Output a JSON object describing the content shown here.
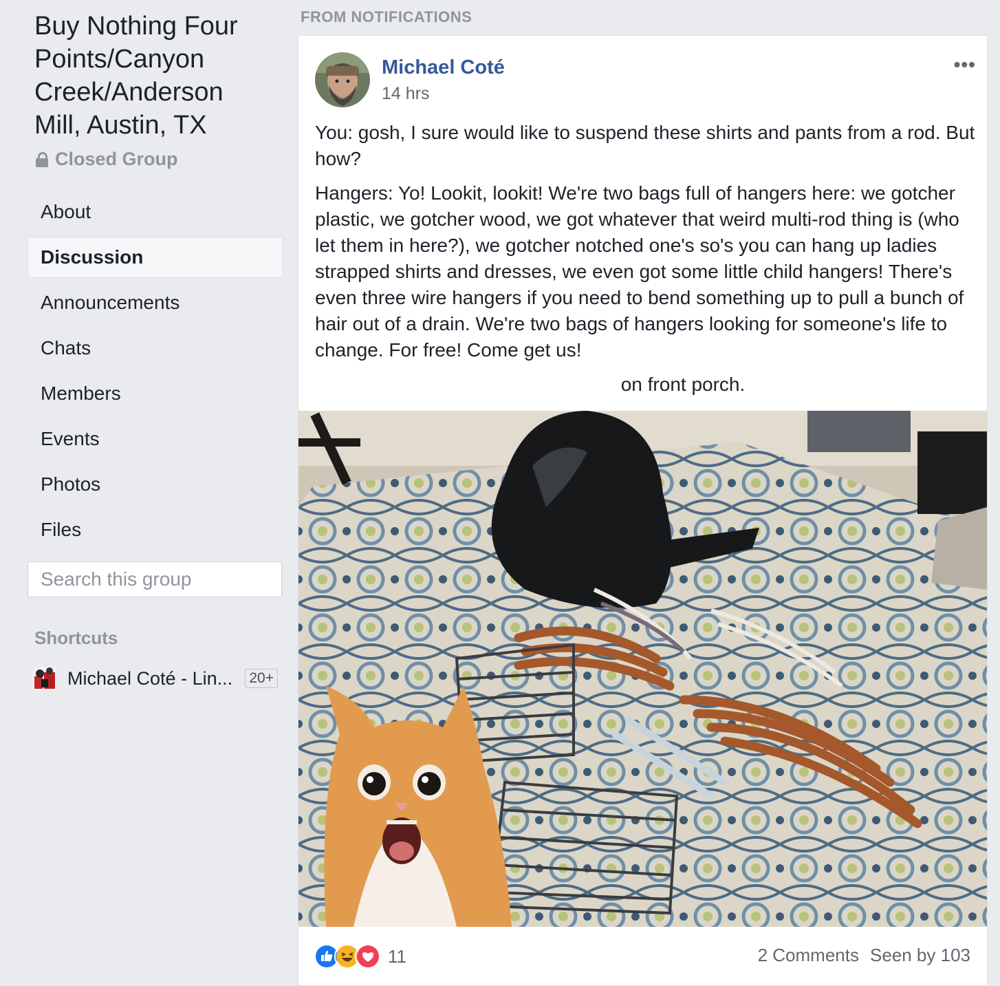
{
  "group": {
    "title": "Buy Nothing Four Points/Canyon Creek/Anderson Mill, Austin, TX",
    "privacy": "Closed Group"
  },
  "nav": {
    "items": [
      {
        "label": "About"
      },
      {
        "label": "Discussion",
        "active": true
      },
      {
        "label": "Announcements"
      },
      {
        "label": "Chats"
      },
      {
        "label": "Members"
      },
      {
        "label": "Events"
      },
      {
        "label": "Photos"
      },
      {
        "label": "Files"
      }
    ]
  },
  "search": {
    "placeholder": "Search this group",
    "value": ""
  },
  "shortcuts": {
    "title": "Shortcuts",
    "items": [
      {
        "name": "Michael Coté - Lin...",
        "badge": "20+"
      }
    ]
  },
  "feed": {
    "section_label": "FROM NOTIFICATIONS"
  },
  "post": {
    "author": "Michael Coté",
    "time": "14 hrs",
    "paragraphs": [
      "You: gosh, I sure would like to suspend these shirts and pants from a rod. But how?",
      "Hangers: Yo! Lookit, lookit! We're two bags full of hangers here: we gotcher plastic, we gotcher wood, we got whatever that weird multi-rod thing is (who let them in here?), we gotcher notched one's so's you can hang up ladies strapped shirts and dresses, we even got some little child hangers! There's even three wire hangers if you need to bend something up to pull a bunch of hair out of a drain. We're two bags of hangers looking for someone's life to change. For free! Come get us!",
      "on front porch."
    ],
    "reaction_count": "11",
    "comments": "2 Comments",
    "seen_by": "Seen by 103"
  },
  "colors": {
    "link": "#365899",
    "page_bg": "#e9ebee",
    "like": "#1877f2",
    "haha": "#f7b125",
    "love": "#f33e58"
  }
}
